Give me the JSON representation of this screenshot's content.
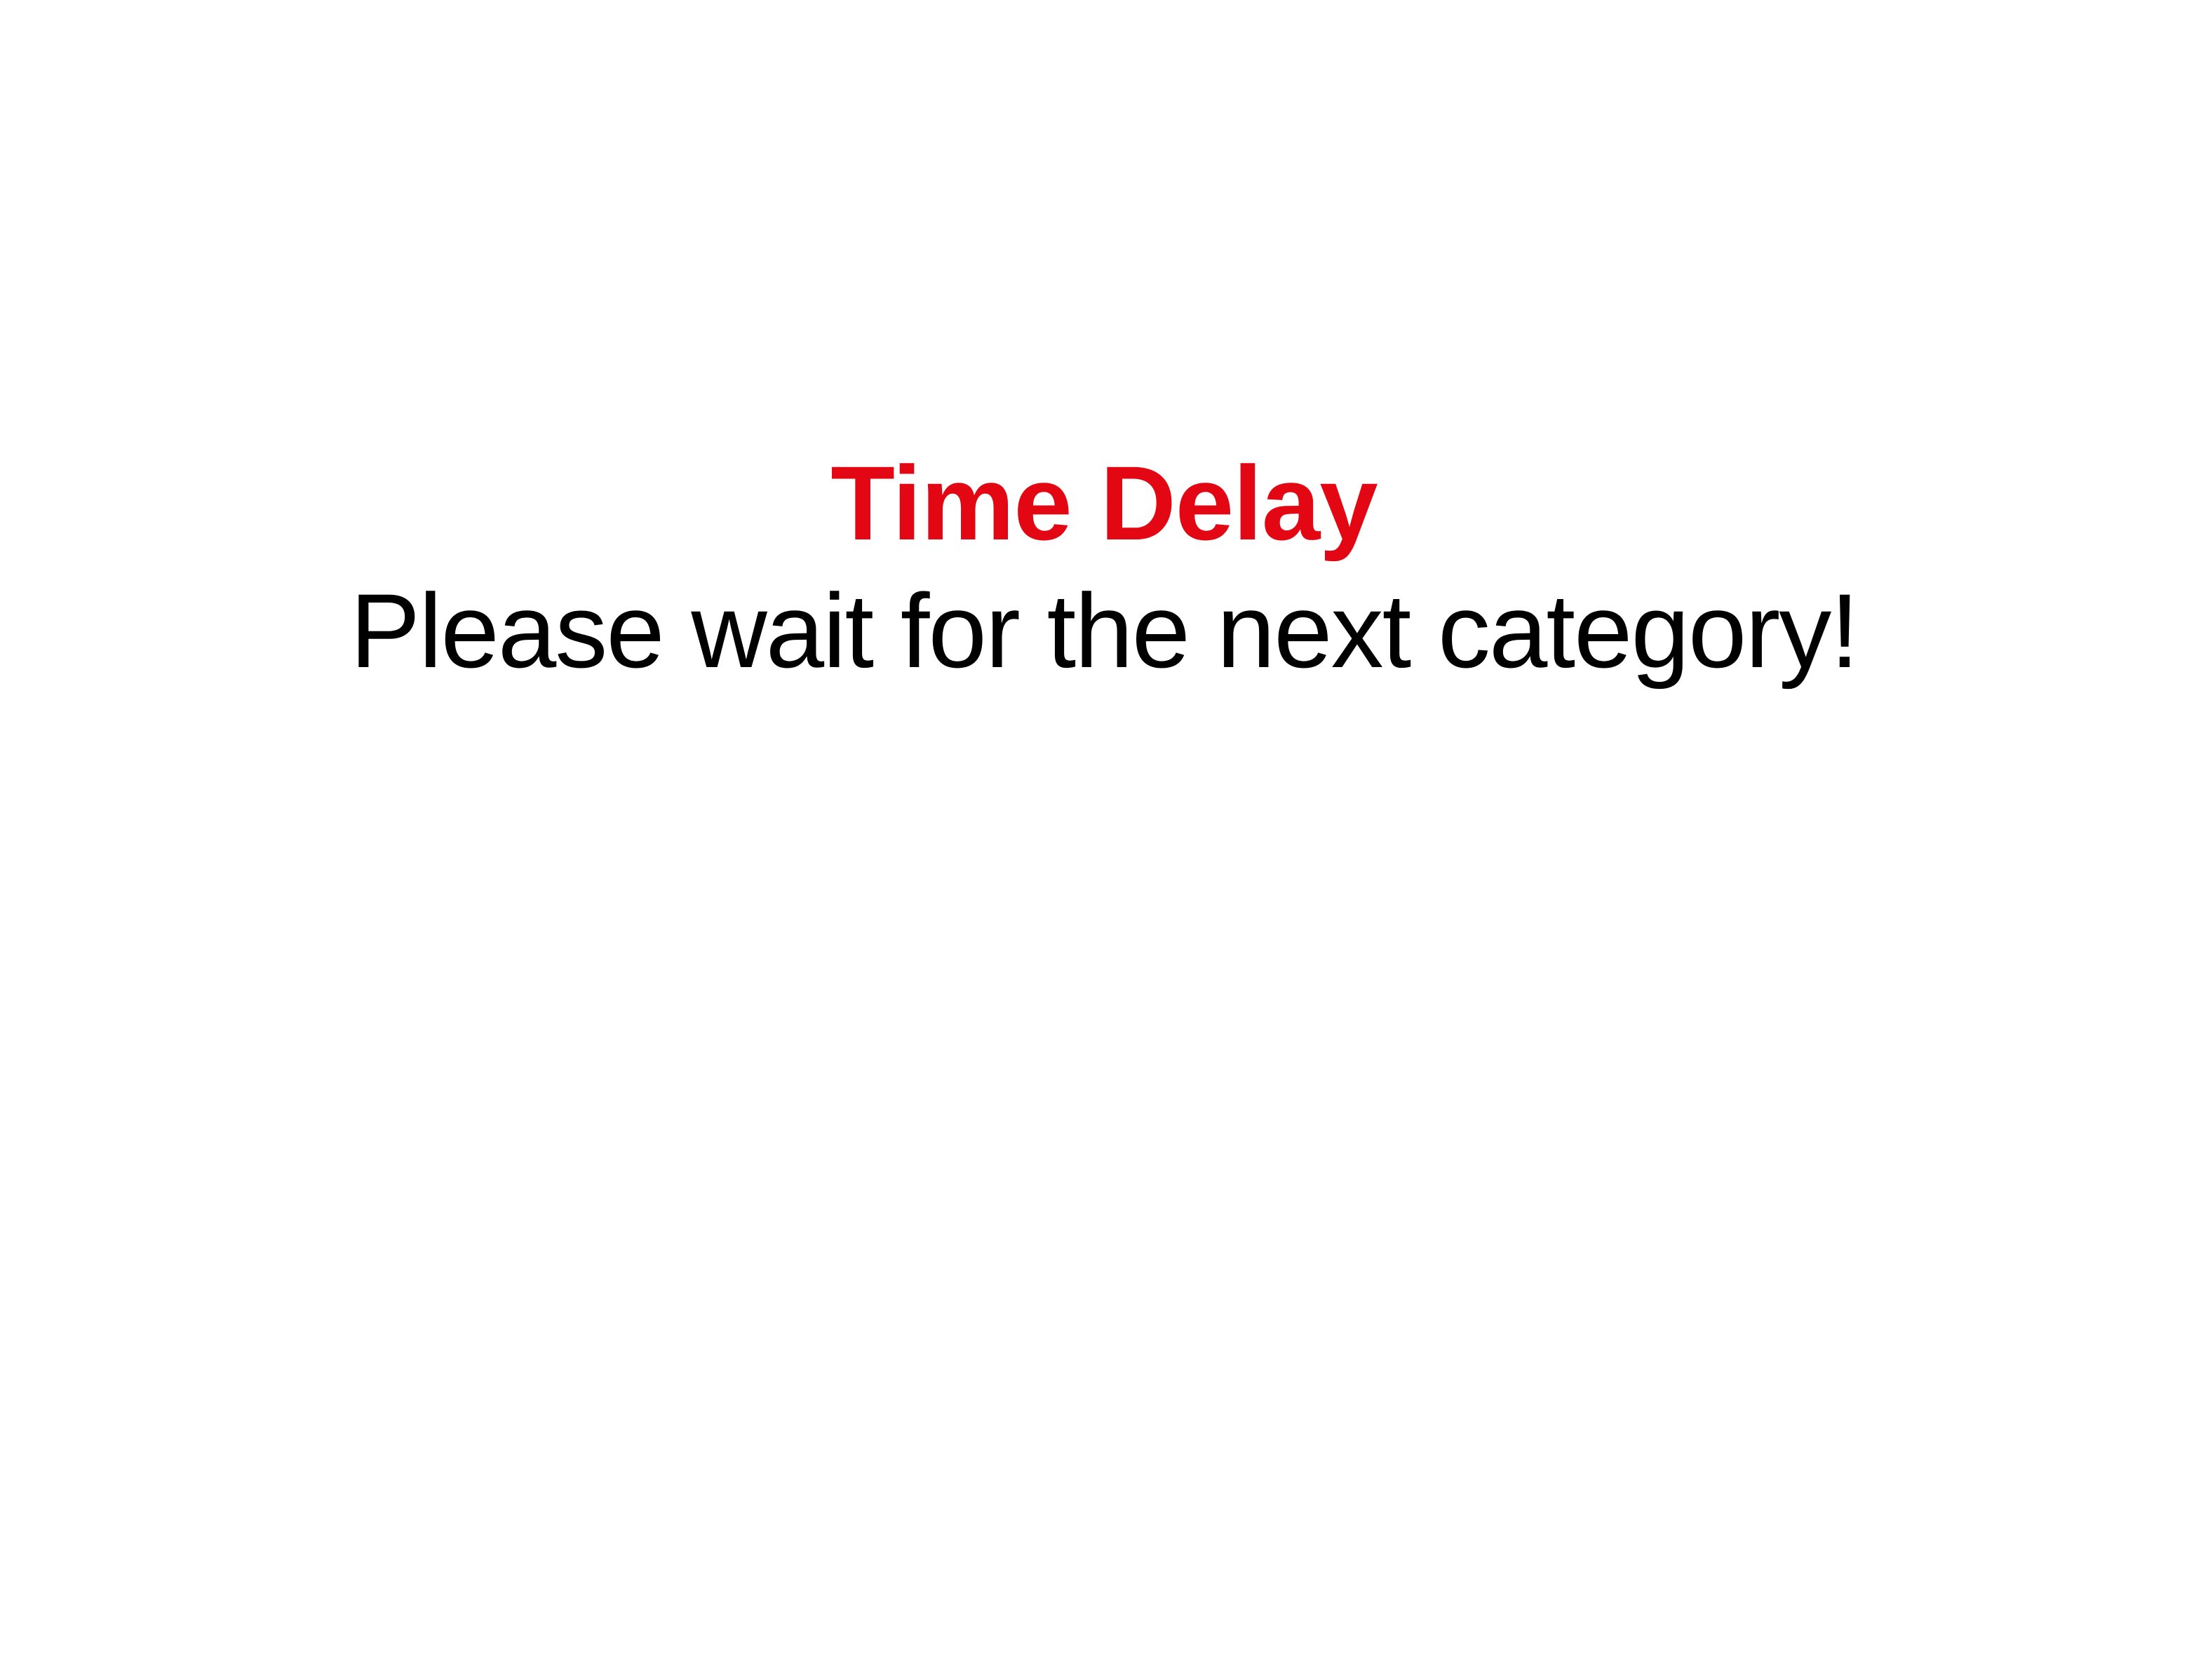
{
  "screen": {
    "title": "Time Delay",
    "subtitle": "Please wait for the next category!"
  },
  "colors": {
    "title": "#e30613",
    "subtitle": "#000000",
    "background": "#ffffff"
  }
}
